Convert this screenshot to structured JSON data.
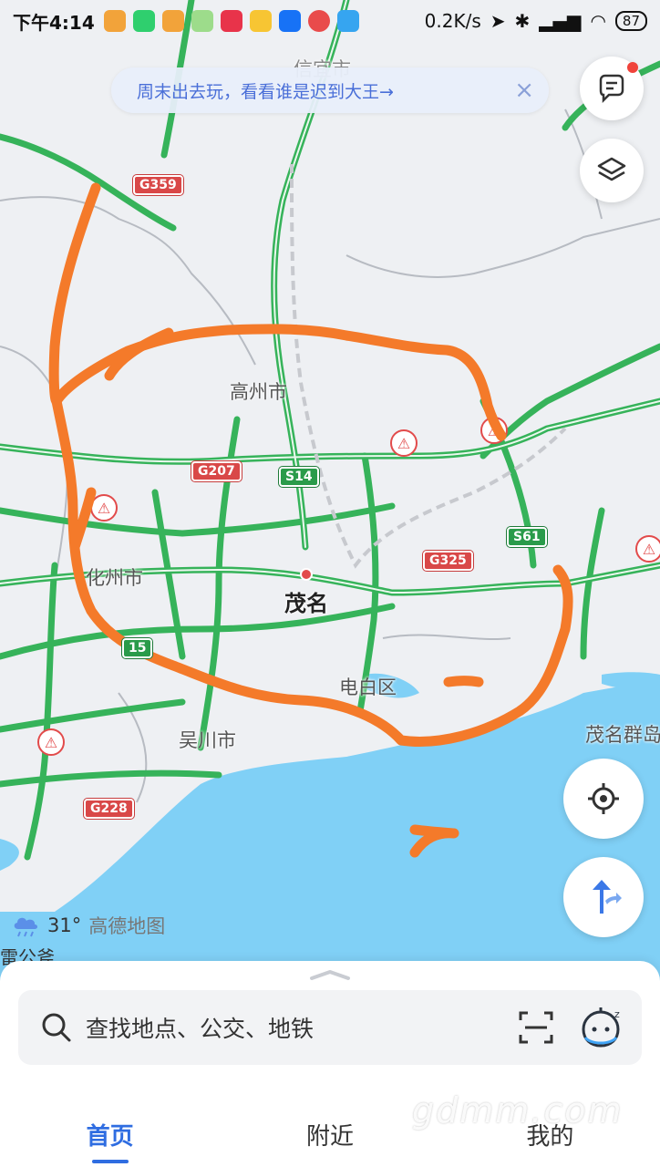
{
  "status_bar": {
    "time": "下午4:14",
    "network_speed": "0.2K/s",
    "battery": "87"
  },
  "banner": {
    "text": "周末出去玩，看看谁是迟到大王→",
    "close_glyph": "×"
  },
  "map": {
    "labels": {
      "top_cut": "信宜市",
      "gaozhou": "高州市",
      "huazhou": "化州市",
      "maoming": "茂名",
      "dianbai": "电白区",
      "wuchuan": "吴川市",
      "maoming_islands": "茂名群岛"
    },
    "shields": {
      "g359": "G359",
      "g207": "G207",
      "s14": "S14",
      "g325": "G325",
      "s61": "S61",
      "g228": "G228",
      "s15": "15"
    },
    "colors": {
      "sea": "#7fd0f7",
      "land": "#eef0f3",
      "road": "#36b35a",
      "annotation": "#f47a2a"
    }
  },
  "weather": {
    "temp": "31°",
    "brand": "高德地图",
    "cut_label": "雷公斧"
  },
  "search": {
    "placeholder": "查找地点、公交、地铁"
  },
  "tabs": [
    {
      "label": "首页"
    },
    {
      "label": "附近"
    },
    {
      "label": "我的"
    }
  ],
  "watermark": "gdmm.com"
}
